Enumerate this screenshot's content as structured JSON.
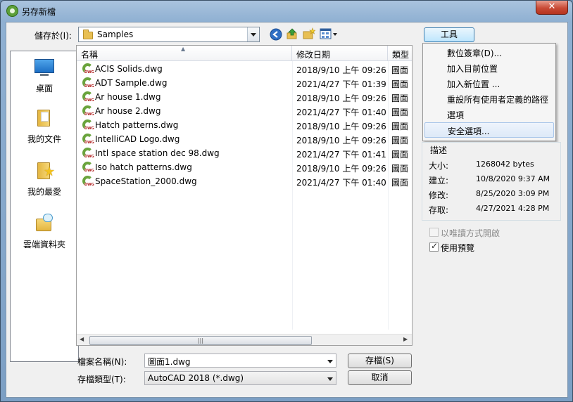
{
  "window": {
    "title": "另存新檔",
    "close_label": "✕"
  },
  "location": {
    "label": "儲存於(I):",
    "value": "Samples"
  },
  "toolbar": {
    "tools_label": "工具"
  },
  "places": [
    {
      "label": "桌面"
    },
    {
      "label": "我的文件"
    },
    {
      "label": "我的最愛"
    },
    {
      "label": "雲端資料夾"
    }
  ],
  "columns": {
    "name": "名稱",
    "modified": "修改日期",
    "type": "類型"
  },
  "files": [
    {
      "name": "ACIS Solids.dwg",
      "modified": "2018/9/10 上午 09:26",
      "type": "圖面"
    },
    {
      "name": "ADT Sample.dwg",
      "modified": "2021/4/27 下午 01:39",
      "type": "圖面"
    },
    {
      "name": "Ar house 1.dwg",
      "modified": "2018/9/10 上午 09:26",
      "type": "圖面"
    },
    {
      "name": "Ar house 2.dwg",
      "modified": "2021/4/27 下午 01:40",
      "type": "圖面"
    },
    {
      "name": "Hatch patterns.dwg",
      "modified": "2018/9/10 上午 09:26",
      "type": "圖面"
    },
    {
      "name": "IntelliCAD Logo.dwg",
      "modified": "2018/9/10 上午 09:26",
      "type": "圖面"
    },
    {
      "name": "Intl space station dec 98.dwg",
      "modified": "2021/4/27 下午 01:41",
      "type": "圖面"
    },
    {
      "name": "Iso hatch patterns.dwg",
      "modified": "2018/9/10 上午 09:26",
      "type": "圖面"
    },
    {
      "name": "SpaceStation_2000.dwg",
      "modified": "2021/4/27 下午 01:40",
      "type": "圖面"
    }
  ],
  "tools_menu": [
    {
      "label": "數位簽章(D)..."
    },
    {
      "label": "加入目前位置"
    },
    {
      "label": "加入新位置 ..."
    },
    {
      "label": "重設所有使用者定義的路徑"
    },
    {
      "label": "選項"
    },
    {
      "label": "安全選項..."
    }
  ],
  "description": {
    "title": "描述",
    "size_label": "大小:",
    "size_value": "1268042 bytes",
    "created_label": "建立:",
    "created_value": "10/8/2020 9:37 AM",
    "modified_label": "修改:",
    "modified_value": "8/25/2020 3:09 PM",
    "accessed_label": "存取:",
    "accessed_value": "4/27/2021 4:28 PM"
  },
  "options": {
    "readonly_label": "以唯讀方式開啟",
    "readonly_checked": false,
    "readonly_enabled": false,
    "preview_label": "使用預覽",
    "preview_checked": true
  },
  "filename": {
    "label": "檔案名稱(N):",
    "value": "圖面1.dwg"
  },
  "filetype": {
    "label": "存檔類型(T):",
    "value": "AutoCAD 2018 (*.dwg)"
  },
  "buttons": {
    "save": "存檔(S)",
    "cancel": "取消"
  },
  "scrollbar": {
    "grip": "|||"
  },
  "colors": {
    "accent": "#3399ff",
    "dwg_green": "#6aa43d",
    "close_red": "#c94a36"
  }
}
